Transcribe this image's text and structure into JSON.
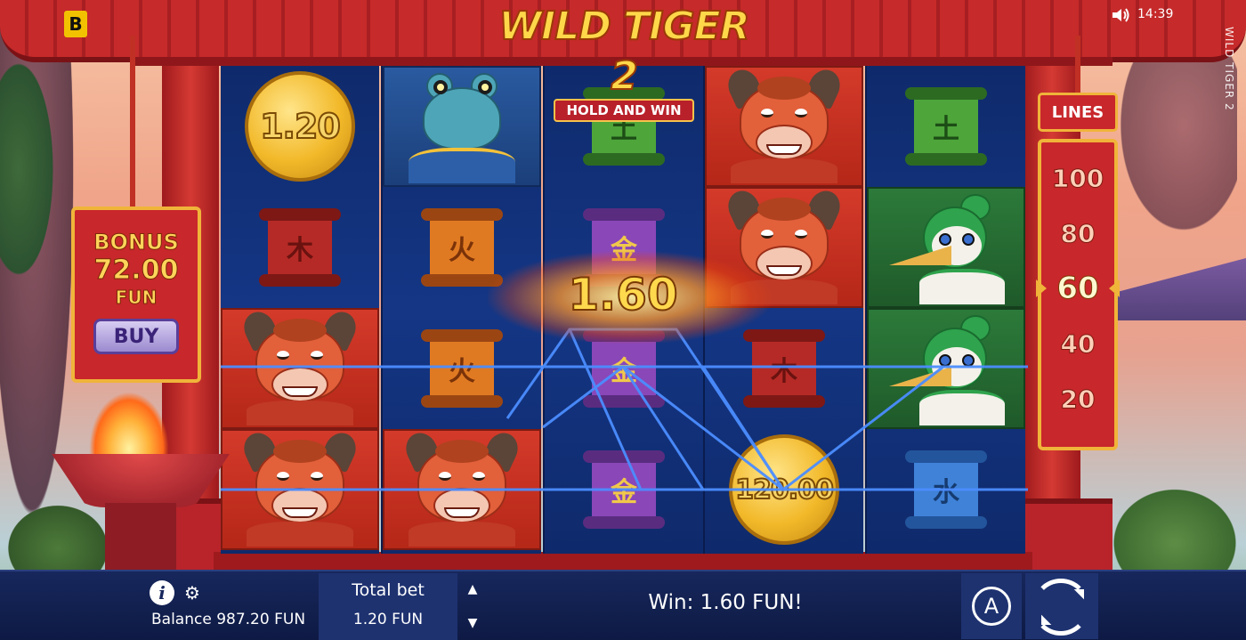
{
  "game": {
    "title": "WILD TIGER 2",
    "subtitle": "HOLD AND WIN",
    "side_title": "WILD TIGER 2",
    "brand_badge": "B"
  },
  "status": {
    "clock": "14:39",
    "sound_icon": "speaker-icon"
  },
  "bonus": {
    "label": "BONUS",
    "amount": "72.00",
    "currency": "FUN",
    "buy_label": "BUY"
  },
  "lines": {
    "label": "LINES",
    "options": [
      "100",
      "80",
      "60",
      "40",
      "20"
    ],
    "selected": "60"
  },
  "reels": {
    "columns": [
      [
        "coin:1.20",
        "scroll-wood",
        "bull",
        "bull"
      ],
      [
        "frog",
        "scroll-fire",
        "scroll-fire",
        "bull"
      ],
      [
        "scroll-earth",
        "scroll-metal",
        "scroll-metal",
        "scroll-metal"
      ],
      [
        "bull",
        "bull",
        "scroll-wood",
        "coin:120.00"
      ],
      [
        "scroll-earth",
        "crane",
        "crane",
        "scroll-water"
      ]
    ],
    "coin_values": [
      "1.20",
      "120.00"
    ],
    "glyphs": {
      "wood": "木",
      "fire": "火",
      "earth": "土",
      "metal": "金",
      "water": "水"
    }
  },
  "win": {
    "amount": "1.60"
  },
  "bottom_bar": {
    "info_icon": "info-icon",
    "settings_icon": "gear-icon",
    "balance": "Balance 987.20 FUN",
    "total_bet_label": "Total bet",
    "total_bet_value": "1.20 FUN",
    "win_message": "Win: 1.60 FUN!",
    "auto_label": "A"
  }
}
